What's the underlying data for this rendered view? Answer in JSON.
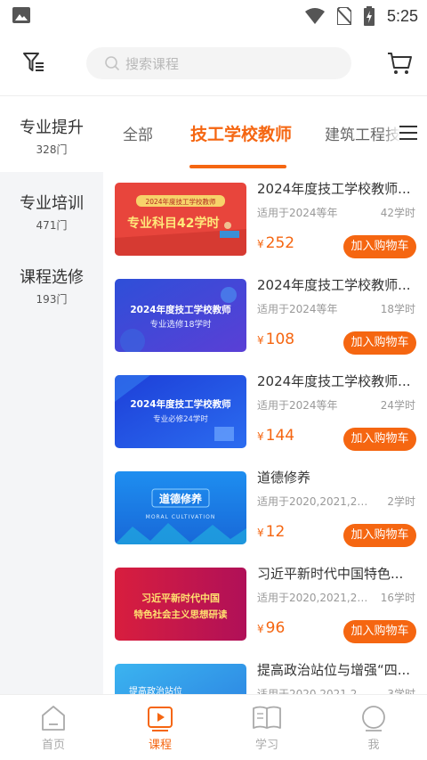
{
  "status_bar": {
    "time": "5:25"
  },
  "header": {
    "search_placeholder": "搜索课程"
  },
  "sidebar": {
    "items": [
      {
        "name": "专业提升",
        "count": "328门"
      },
      {
        "name": "专业培训",
        "count": "471门"
      },
      {
        "name": "课程选修",
        "count": "193门"
      }
    ]
  },
  "tabs": [
    "全部",
    "技工学校教师",
    "建筑工程技"
  ],
  "courses": [
    {
      "title": "2024年度技工学校教师...",
      "target": "适用于2024等年",
      "hours": "42学时",
      "price": "252",
      "btn": "加入购物车",
      "thumb": {
        "line1": "2024年度技工学校教师",
        "line2": "专业科目42学时"
      }
    },
    {
      "title": "2024年度技工学校教师...",
      "target": "适用于2024等年",
      "hours": "18学时",
      "price": "108",
      "btn": "加入购物车",
      "thumb": {
        "line1": "2024年度技工学校教师",
        "line2": "专业选修18学时"
      }
    },
    {
      "title": "2024年度技工学校教师...",
      "target": "适用于2024等年",
      "hours": "24学时",
      "price": "144",
      "btn": "加入购物车",
      "thumb": {
        "line1": "2024年度技工学校教师",
        "line2": "专业必修24学时"
      }
    },
    {
      "title": "道德修养",
      "target": "适用于2020,2021,202...",
      "hours": "2学时",
      "price": "12",
      "btn": "加入购物车",
      "thumb": {
        "line1": "道德修养",
        "line2": "MORAL CULTIVATION"
      }
    },
    {
      "title": "习近平新时代中国特色...",
      "target": "适用于2020,2021,20...",
      "hours": "16学时",
      "price": "96",
      "btn": "加入购物车",
      "thumb": {
        "line1": "习近平新时代中国",
        "line2": "特色社会主义思想研读"
      }
    },
    {
      "title": "提高政治站位与增强“四...",
      "target": "适用于2020,2021,20...",
      "hours": "3学时",
      "price": "",
      "btn": "",
      "thumb": {
        "line1": "提高政治站位",
        "line2": ""
      }
    }
  ],
  "currency": "¥",
  "bottom_nav": [
    {
      "label": "首页",
      "icon": "home-icon"
    },
    {
      "label": "课程",
      "icon": "video-icon"
    },
    {
      "label": "学习",
      "icon": "book-icon"
    },
    {
      "label": "我",
      "icon": "user-icon"
    }
  ],
  "colors": {
    "accent": "#f56611",
    "sidebar_bg": "#f4f5f7"
  }
}
